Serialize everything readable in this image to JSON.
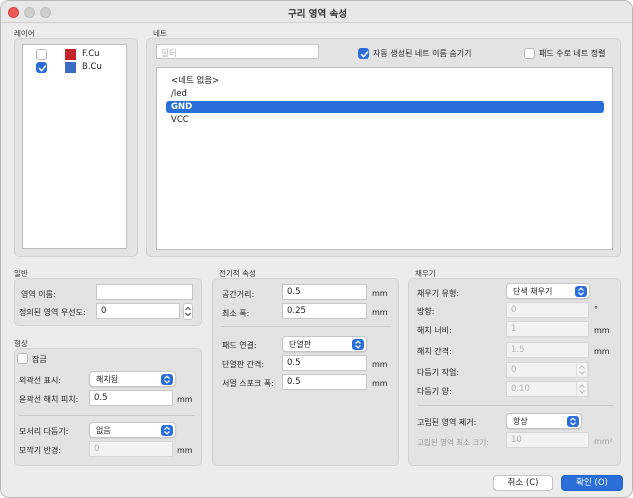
{
  "window": {
    "title": "구리 영역 속성"
  },
  "layers": {
    "section_label": "레이어",
    "items": [
      {
        "name": "F.Cu",
        "checked": false,
        "color": "#c4242c"
      },
      {
        "name": "B.Cu",
        "checked": true,
        "color": "#3d6ac4"
      }
    ]
  },
  "nets": {
    "section_label": "네트",
    "filter_placeholder": "필터",
    "hide_auto_names_label": "자동 생성된 네트 이름 숨기기",
    "hide_auto_names_checked": true,
    "sort_by_pads_label": "패드 수로 네트 정렬",
    "sort_by_pads_checked": false,
    "items": [
      "<네트 없음>",
      "/led",
      "GND",
      "VCC"
    ],
    "selected": "GND"
  },
  "general": {
    "section_label": "일반",
    "zone_name_label": "영역 이름:",
    "zone_name_value": "",
    "priority_label": "정의된 영역 우선도:",
    "priority_value": "0"
  },
  "shape": {
    "section_label": "형상",
    "locked_label": "잠금",
    "locked_checked": false,
    "outline_display_label": "외곽선 표시:",
    "outline_display_value": "해치됨",
    "outline_hatch_pitch_label": "윤곽선 해치 피치:",
    "outline_hatch_pitch_value": "0.5",
    "outline_hatch_pitch_unit": "mm",
    "corner_smoothing_label": "모서리 다듬기:",
    "corner_smoothing_value": "없음",
    "corner_radius_label": "모깍기 반경:",
    "corner_radius_value": "0",
    "corner_radius_unit": "mm"
  },
  "electrical": {
    "section_label": "전기적 속성",
    "clearance_label": "공간거리:",
    "clearance_value": "0.5",
    "clearance_unit": "mm",
    "min_width_label": "최소 폭:",
    "min_width_value": "0.25",
    "min_width_unit": "mm",
    "pad_connection_label": "패드 연결:",
    "pad_connection_value": "단열판",
    "thermal_gap_label": "단열판 간격:",
    "thermal_gap_value": "0.5",
    "thermal_gap_unit": "mm",
    "spoke_width_label": "서멀 스포크 폭:",
    "spoke_width_value": "0.5",
    "spoke_width_unit": "mm"
  },
  "fill": {
    "section_label": "채우기",
    "fill_type_label": "채우기 유형:",
    "fill_type_value": "단색 채우기",
    "orientation_label": "방향:",
    "orientation_value": "0",
    "orientation_unit": "°",
    "hatch_width_label": "해치 너비:",
    "hatch_width_value": "1",
    "hatch_width_unit": "mm",
    "hatch_gap_label": "해치 간격:",
    "hatch_gap_value": "1.5",
    "hatch_gap_unit": "mm",
    "smoothing_effort_label": "다듬기 작업:",
    "smoothing_effort_value": "0",
    "smoothing_amount_label": "다듬기 양:",
    "smoothing_amount_value": "0.10",
    "remove_islands_label": "고립된 영역 제거:",
    "remove_islands_value": "항상",
    "min_island_size_label": "고립된 영역 최소 크기:",
    "min_island_size_value": "10",
    "min_island_size_unit": "mm²"
  },
  "buttons": {
    "cancel": "취소 (C)",
    "ok": "확인 (O)"
  },
  "colors": {
    "accent": "#2a6fd9"
  }
}
